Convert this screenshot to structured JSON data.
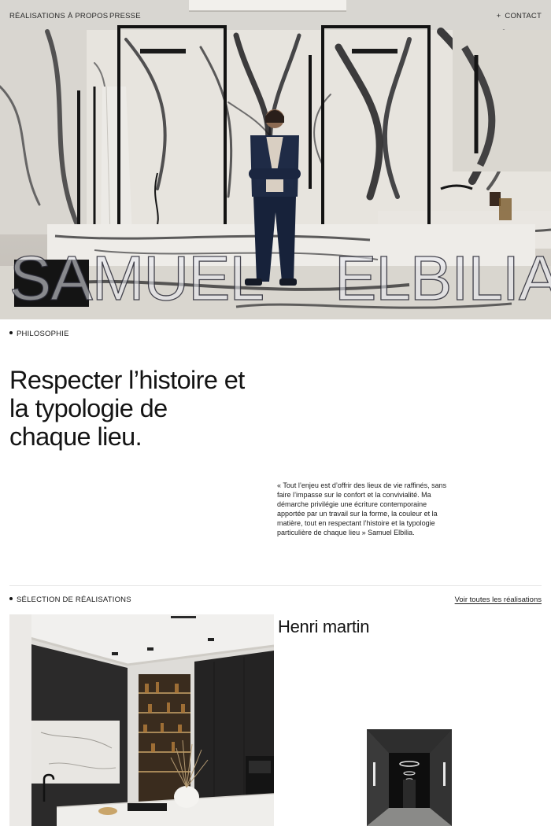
{
  "nav": {
    "realisations": "Réalisations",
    "a_propos": "À propos",
    "presse": "Presse",
    "contact": "Contact",
    "contact_prefix": "+"
  },
  "hero": {
    "first_name": "SAMUEL",
    "last_name": "ELBILIA"
  },
  "philosophy": {
    "label": "Philosophie",
    "heading": "Respecter l’histoire et la typologie de chaque lieu.",
    "quote": "« Tout l’enjeu est d’offrir des lieux de vie raffinés, sans faire l’impasse sur le confort et la convivialité. Ma démarche privilégie une écriture contemporaine apportée par un travail sur la forme, la couleur et la matière, tout en respectant l’histoire et la typologie particulière de chaque lieu » Samuel Elbilia."
  },
  "selection": {
    "label": "Sélection de réalisations",
    "see_all": "Voir toutes les réalisations",
    "project_title": "Henri martin"
  },
  "colors": {
    "text": "#111111",
    "marble": "#e6e3dd",
    "vein": "#1c1c1e",
    "frame": "#151515",
    "divider": "#e6e6e6"
  }
}
